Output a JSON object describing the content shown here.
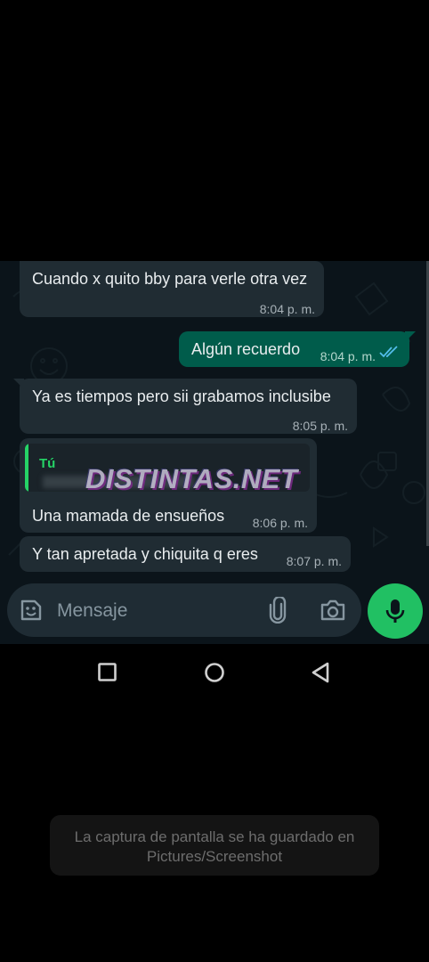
{
  "messages": [
    {
      "direction": "in",
      "text": "Cuando x quito bby para verle otra vez",
      "time": "8:04 p. m."
    },
    {
      "direction": "out",
      "text": "Algún recuerdo",
      "time": "8:04 p. m.",
      "status_icon": "double-check-read-icon"
    },
    {
      "direction": "in",
      "text": "Ya es tiempos pero sii grabamos inclusibe",
      "time": "8:05 p. m."
    },
    {
      "direction": "in",
      "reply_to": {
        "author": "Tú"
      },
      "text": "Una mamada de ensueños",
      "time": "8:06 p. m."
    },
    {
      "direction": "in",
      "text": "Y tan apretada y chiquita q eres",
      "time": "8:07 p. m."
    }
  ],
  "watermark": "DISTINTAS.NET",
  "composer": {
    "placeholder": "Mensaje",
    "icons": [
      "sticker-icon",
      "attach-icon",
      "camera-icon",
      "microphone-icon"
    ]
  },
  "nav": {
    "icons": [
      "recents-square-icon",
      "home-circle-icon",
      "back-triangle-icon"
    ]
  },
  "toast": {
    "line1": "La captura de pantalla se ha guardado en",
    "line2": "Pictures/Screenshot"
  },
  "colors": {
    "chat_bg": "#0b141a",
    "incoming_bubble": "#202c33",
    "outgoing_bubble": "#005c4b",
    "accent_green": "#21c063",
    "read_ticks": "#53bdeb"
  }
}
